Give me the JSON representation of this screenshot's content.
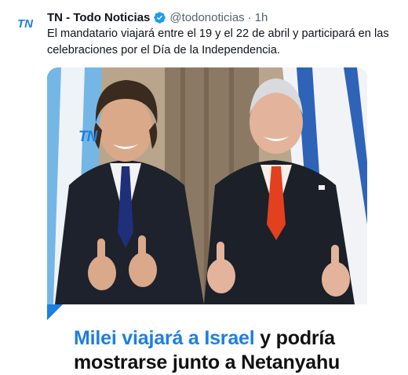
{
  "account": {
    "display_name": "TN - Todo Noticias",
    "handle": "@todonoticias",
    "separator": "·",
    "time": "1h",
    "avatar_text": "TN",
    "verified_color": "#1d9bf0"
  },
  "tweet": {
    "text": "El mandatario viajará entre el 19 y el 22 de abril y participará en las celebraciones por el Día de la Independencia."
  },
  "card": {
    "photo_logo": "TN",
    "headline_blue": "Milei viajará a Israel",
    "headline_rest": " y podría",
    "headline_line2": "mostrarse junto a Netanyahu",
    "accent_color": "#1d7fe0"
  }
}
